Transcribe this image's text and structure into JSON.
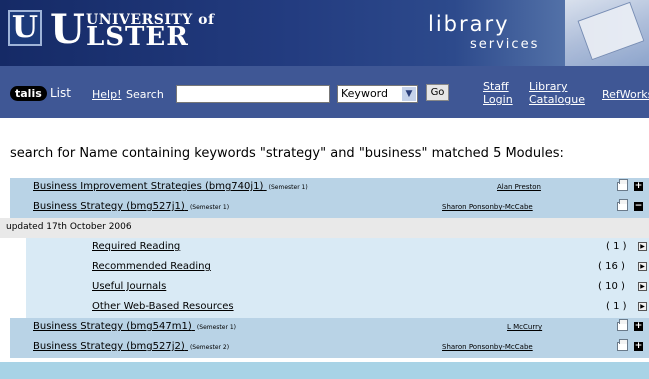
{
  "header": {
    "logo_letter": "U",
    "logo_initial": "U",
    "logo_line1": "UNIVERSITY of",
    "logo_line2": "LSTER",
    "library_title": "library",
    "library_subtitle": "services"
  },
  "toolbar": {
    "talis_label": "talis",
    "list_label": "List",
    "help_label": "Help!",
    "search_label": "Search",
    "search_value": "",
    "search_type_selected": "Keyword",
    "go_label": "Go",
    "staff_login_line1": "Staff",
    "staff_login_line2": "Login",
    "library_catalogue_line1": "Library",
    "library_catalogue_line2": "Catalogue",
    "refworks_label": "RefWorks"
  },
  "results": {
    "heading": "search for Name containing keywords \"strategy\" and \"business\" matched 5 Modules:",
    "modules": [
      {
        "title": "Business Improvement Strategies (bmg740j1)",
        "semester": "(Semester 1)",
        "lecturer": "Alan Preston",
        "toggle": "+"
      },
      {
        "title": "Business Strategy (bmg527j1)",
        "semester": "(Semester 1)",
        "lecturer": "Sharon Ponsonby-McCabe",
        "toggle": "−"
      },
      {
        "title": "Business Strategy (bmg547m1)",
        "semester": "(Semester 1)",
        "lecturer": "L McCurry",
        "toggle": "+"
      },
      {
        "title": "Business Strategy (bmg527j2)",
        "semester": "(Semester 2)",
        "lecturer": "Sharon Ponsonby-McCabe",
        "toggle": "+"
      }
    ],
    "updated_text": "updated 17th October 2006",
    "lists": [
      {
        "label": "Required Reading",
        "count": "( 1 )"
      },
      {
        "label": "Recommended Reading",
        "count": "( 16 )"
      },
      {
        "label": "Useful Journals",
        "count": "( 10 )"
      },
      {
        "label": "Other Web-Based Resources",
        "count": "( 1 )"
      }
    ]
  },
  "icons": {
    "print": "printer-icon",
    "expand": "plus-icon",
    "collapse": "minus-icon",
    "open_list": "arrow-right-icon",
    "dropdown": "chevron-down-icon"
  }
}
